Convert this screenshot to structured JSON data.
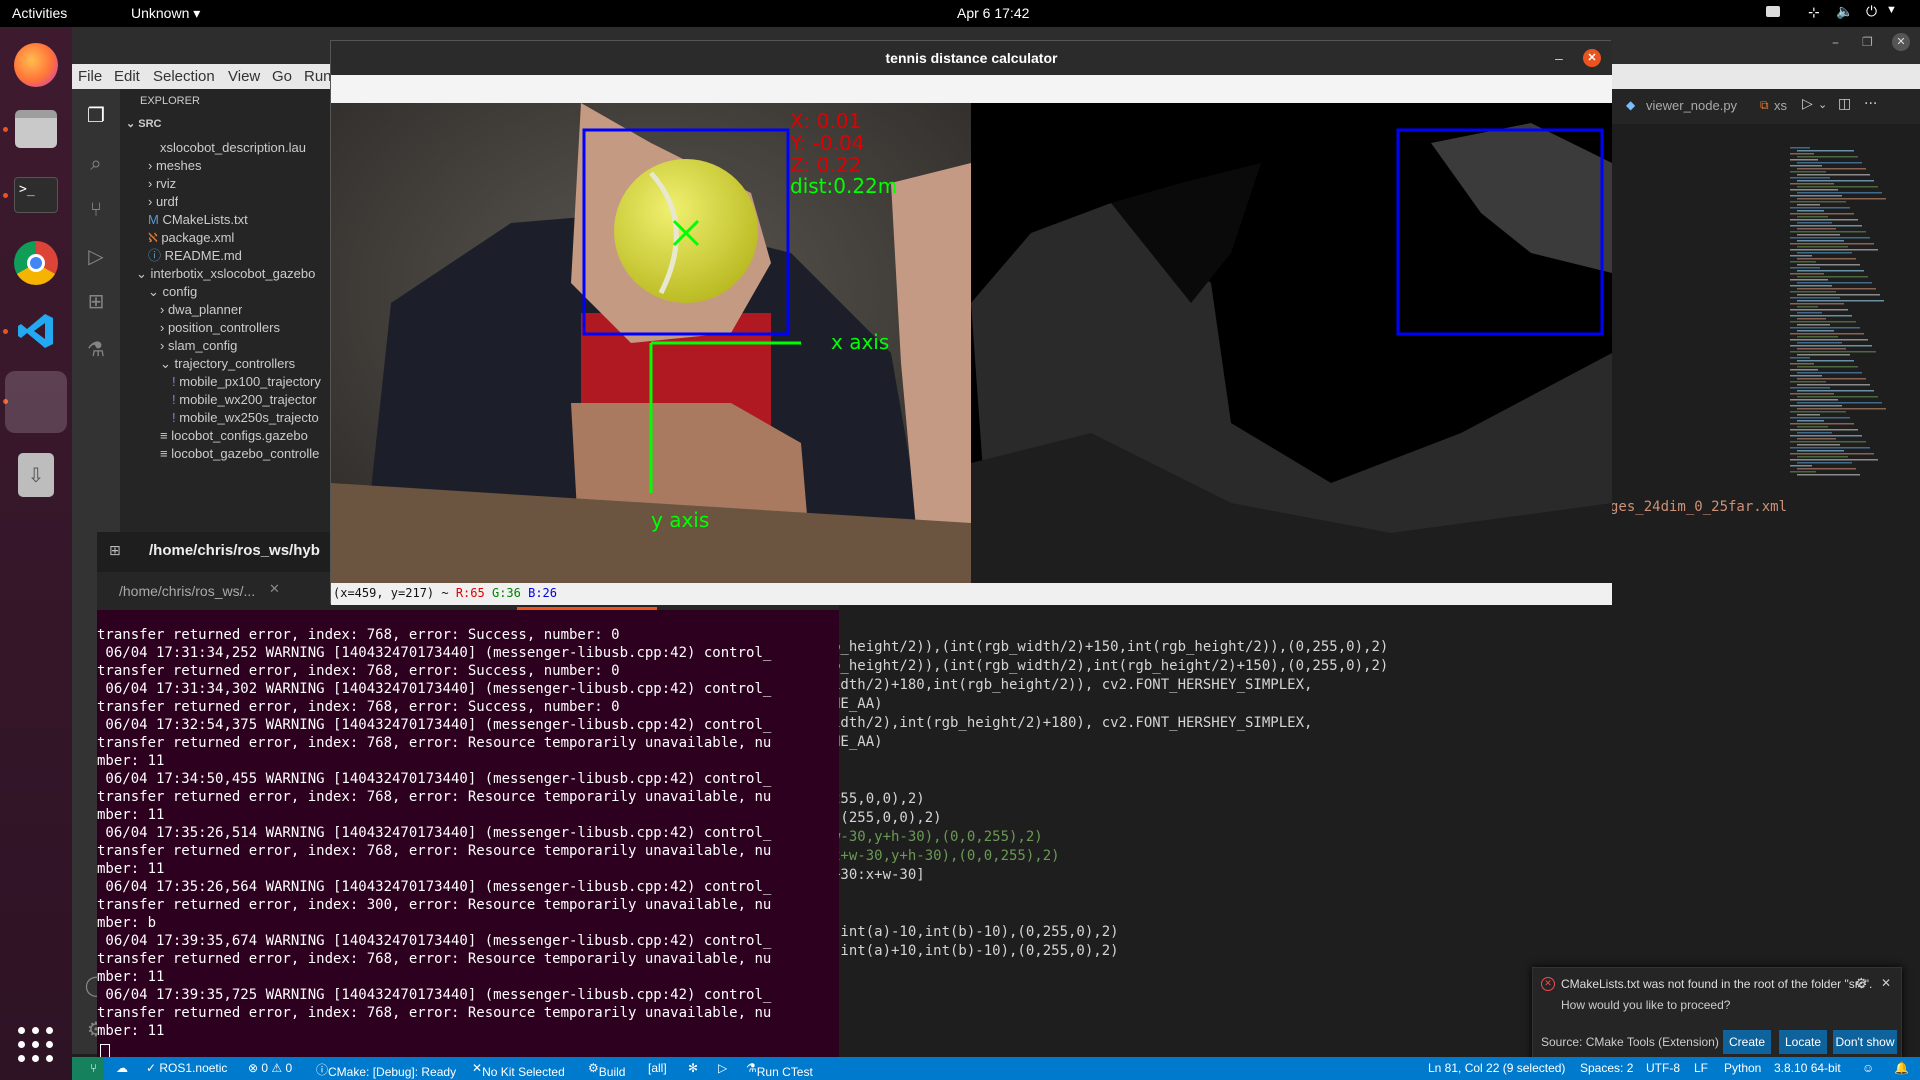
{
  "topbar": {
    "activities": "Activities",
    "app_menu": "Unknown ▾",
    "clock": "Apr 6  17:42"
  },
  "vscode": {
    "menu": [
      "File",
      "Edit",
      "Selection",
      "View",
      "Go",
      "Run"
    ],
    "explorer_title": "EXPLORER",
    "section": "SRC",
    "tree": [
      {
        "label": "xslocobot_description.lau",
        "indent": 2,
        "kind": "file-partial"
      },
      {
        "label": "meshes",
        "indent": 1,
        "kind": "folder-collapsed"
      },
      {
        "label": "rviz",
        "indent": 1,
        "kind": "folder-collapsed"
      },
      {
        "label": "urdf",
        "indent": 1,
        "kind": "folder-collapsed"
      },
      {
        "label": "CMakeLists.txt",
        "indent": 1,
        "kind": "cmake"
      },
      {
        "label": "package.xml",
        "indent": 1,
        "kind": "rss"
      },
      {
        "label": "README.md",
        "indent": 1,
        "kind": "info"
      },
      {
        "label": "interbotix_xslocobot_gazebo",
        "indent": 0,
        "kind": "folder-open"
      },
      {
        "label": "config",
        "indent": 1,
        "kind": "folder-open"
      },
      {
        "label": "dwa_planner",
        "indent": 2,
        "kind": "folder-collapsed"
      },
      {
        "label": "position_controllers",
        "indent": 2,
        "kind": "folder-collapsed"
      },
      {
        "label": "slam_config",
        "indent": 2,
        "kind": "folder-collapsed"
      },
      {
        "label": "trajectory_controllers",
        "indent": 2,
        "kind": "folder-open"
      },
      {
        "label": "mobile_px100_trajectory",
        "indent": 3,
        "kind": "yaml"
      },
      {
        "label": "mobile_wx200_trajector",
        "indent": 3,
        "kind": "yaml"
      },
      {
        "label": "mobile_wx250s_trajecto",
        "indent": 3,
        "kind": "yaml"
      },
      {
        "label": "locobot_configs.gazebo",
        "indent": 2,
        "kind": "list"
      },
      {
        "label": "locobot_gazebo_controlle",
        "indent": 2,
        "kind": "list"
      }
    ],
    "editor_tab": "viewer_node.py",
    "editor_tab2": "xs",
    "code_lines": [
      "b_height/2)),(int(rgb_width/2)+150,int(rgb_height/2)),(0,255,0),2)",
      "b_height/2)),(int(rgb_width/2),int(rgb_height/2)+150),(0,255,0),2)",
      "idth/2)+180,int(rgb_height/2)), cv2.FONT_HERSHEY_SIMPLEX,",
      "NE_AA)",
      "idth/2),int(rgb_height/2)+180), cv2.FONT_HERSHEY_SIMPLEX,",
      "NE_AA)",
      "",
      "",
      "255,0,0),2)",
      ",(255,0,0),2)",
      "w-30,y+h-30),(0,0,255),2)",
      "x+w-30,y+h-30),(0,0,255),2)",
      "+30:x+w-30]",
      "",
      "",
      "(int(a)-10,int(b)-10),(0,255,0),2)",
      "(int(a)+10,int(b)-10),(0,255,0),2)"
    ],
    "code_fragment_right": "ges_24dim_0_25far.xml",
    "statusbar": {
      "ros": "✓ ROS1.noetic",
      "problems": "⊗ 0 ⚠ 0",
      "cmake": "CMake: [Debug]: Ready",
      "kit": "No Kit Selected",
      "build": "Build",
      "all": "[all]",
      "ctest": "Run CTest",
      "position": "Ln 81, Col 22 (9 selected)",
      "spaces": "Spaces: 2",
      "encoding": "UTF-8",
      "eol": "LF",
      "language": "Python",
      "python": "3.8.10 64-bit"
    },
    "notification": {
      "message": "CMakeLists.txt was not found in the root of the folder \"src\".",
      "question": "How would you like to proceed?",
      "source": "Source: CMake Tools (Extension)",
      "btn_create": "Create",
      "btn_locate": "Locate",
      "btn_dont_show": "Don't show again"
    }
  },
  "terminal": {
    "header_path": "/home/chris/ros_ws/hyb",
    "tab_label": "/home/chris/ros_ws/...",
    "lines": [
      "transfer returned error, index: 768, error: Success, number: 0",
      " 06/04 17:31:34,252 WARNING [140432470173440] (messenger-libusb.cpp:42) control_",
      "transfer returned error, index: 768, error: Success, number: 0",
      " 06/04 17:31:34,302 WARNING [140432470173440] (messenger-libusb.cpp:42) control_",
      "transfer returned error, index: 768, error: Success, number: 0",
      " 06/04 17:32:54,375 WARNING [140432470173440] (messenger-libusb.cpp:42) control_",
      "transfer returned error, index: 768, error: Resource temporarily unavailable, nu",
      "mber: 11",
      " 06/04 17:34:50,455 WARNING [140432470173440] (messenger-libusb.cpp:42) control_",
      "transfer returned error, index: 768, error: Resource temporarily unavailable, nu",
      "mber: 11",
      " 06/04 17:35:26,514 WARNING [140432470173440] (messenger-libusb.cpp:42) control_",
      "transfer returned error, index: 768, error: Resource temporarily unavailable, nu",
      "mber: 11",
      " 06/04 17:35:26,564 WARNING [140432470173440] (messenger-libusb.cpp:42) control_",
      "transfer returned error, index: 300, error: Resource temporarily unavailable, nu",
      "mber: b",
      " 06/04 17:39:35,674 WARNING [140432470173440] (messenger-libusb.cpp:42) control_",
      "transfer returned error, index: 768, error: Resource temporarily unavailable, nu",
      "mber: 11",
      " 06/04 17:39:35,725 WARNING [140432470173440] (messenger-libusb.cpp:42) control_",
      "transfer returned error, index: 768, error: Resource temporarily unavailable, nu",
      "mber: 11"
    ]
  },
  "cv_window": {
    "title": "tennis distance calculator",
    "overlay": {
      "x": "X: 0.01",
      "y": "Y: -0.04",
      "z": "Z: 0.22",
      "dist": "dist:0.22m",
      "x_axis": "x axis",
      "y_axis": "y axis"
    },
    "status_coords": "(x=459, y=217) ~",
    "status_r": "R:65",
    "status_g": "G:36",
    "status_b": "B:26"
  },
  "colors": {
    "accent": "#007acc",
    "ubuntu_orange": "#e95420",
    "terminal_bg": "#2c001e",
    "overlay_red": "#e00000",
    "overlay_green": "#00ff00",
    "overlay_blue": "#0000ff"
  }
}
